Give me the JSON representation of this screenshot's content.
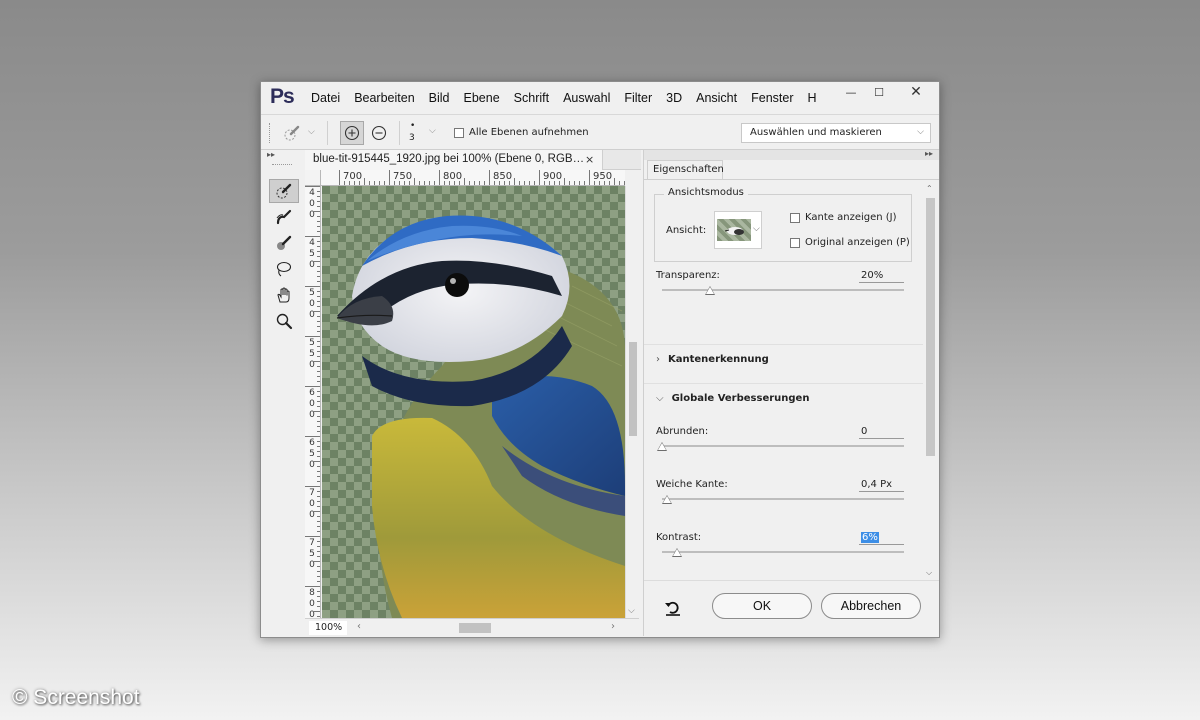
{
  "app": {
    "logo": "Ps"
  },
  "menu": [
    "Datei",
    "Bearbeiten",
    "Bild",
    "Ebene",
    "Schrift",
    "Auswahl",
    "Filter",
    "3D",
    "Ansicht",
    "Fenster",
    "H"
  ],
  "window_controls": {
    "minimize": "—",
    "maximize": "☐",
    "close": "✕"
  },
  "options_bar": {
    "brush_size": "3",
    "sample_all_layers_label": "Alle Ebenen aufnehmen",
    "workspace_select": "Auswählen und maskieren"
  },
  "tools_panel": {
    "collapse_label": "▸▸"
  },
  "document": {
    "tab_title": "blue-tit-915445_1920.jpg bei 100% (Ebene 0, RGB…",
    "close_label": "×",
    "zoom": "100%",
    "ruler_top": [
      "700",
      "750",
      "800",
      "850",
      "900",
      "950"
    ],
    "ruler_left": [
      "4",
      "0",
      "0",
      "4",
      "5",
      "0",
      "5",
      "0",
      "0",
      "5",
      "5",
      "0",
      "6",
      "0",
      "0",
      "6",
      "5",
      "0",
      "7",
      "0",
      "0",
      "7",
      "5",
      "0",
      "8",
      "0",
      "0"
    ]
  },
  "properties": {
    "collapse_label": "▸▸",
    "tab_label": "Eigenschaften",
    "view_mode_legend": "Ansichtsmodus",
    "view_label": "Ansicht:",
    "show_edge_label": "Kante anzeigen (J)",
    "show_original_label": "Original anzeigen (P)",
    "transparency_label": "Transparenz:",
    "transparency_value": "20%",
    "transparency_level": 0.2,
    "edge_detection_label": "Kantenerkennung",
    "global_refinements_label": "Globale Verbesserungen",
    "smooth_label": "Abrunden:",
    "smooth_value": "0",
    "smooth_level": 0,
    "feather_label": "Weiche Kante:",
    "feather_value": "0,4 Px",
    "feather_level": 0.02,
    "contrast_label": "Kontrast:",
    "contrast_value": "6%",
    "contrast_level": 0.06
  },
  "buttons": {
    "ok": "OK",
    "cancel": "Abbrechen"
  },
  "watermark": "© Screenshot",
  "colors": {
    "selection_blue": "#3d8ee6",
    "ps_logo": "#2d2d5a"
  }
}
